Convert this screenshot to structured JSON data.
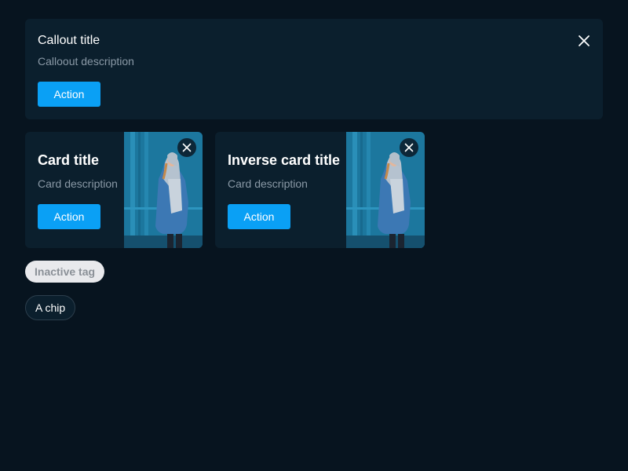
{
  "callout": {
    "title": "Callout title",
    "description": "Calloout description",
    "action_label": "Action",
    "close_icon": "close-icon"
  },
  "cards": [
    {
      "title": "Card title",
      "description": "Card description",
      "action_label": "Action",
      "image": "person-photo",
      "close_icon": "close-icon"
    },
    {
      "title": "Inverse card title",
      "description": "Card description",
      "action_label": "Action",
      "image": "person-photo",
      "close_icon": "close-icon"
    }
  ],
  "tag": {
    "label": "Inactive tag"
  },
  "chip": {
    "label": "A chip"
  },
  "colors": {
    "background": "#07141f",
    "surface": "#0b1f2d",
    "accent": "#0aa0f5",
    "muted_text": "#8a99a6",
    "tag_background": "#e8e9ec"
  }
}
